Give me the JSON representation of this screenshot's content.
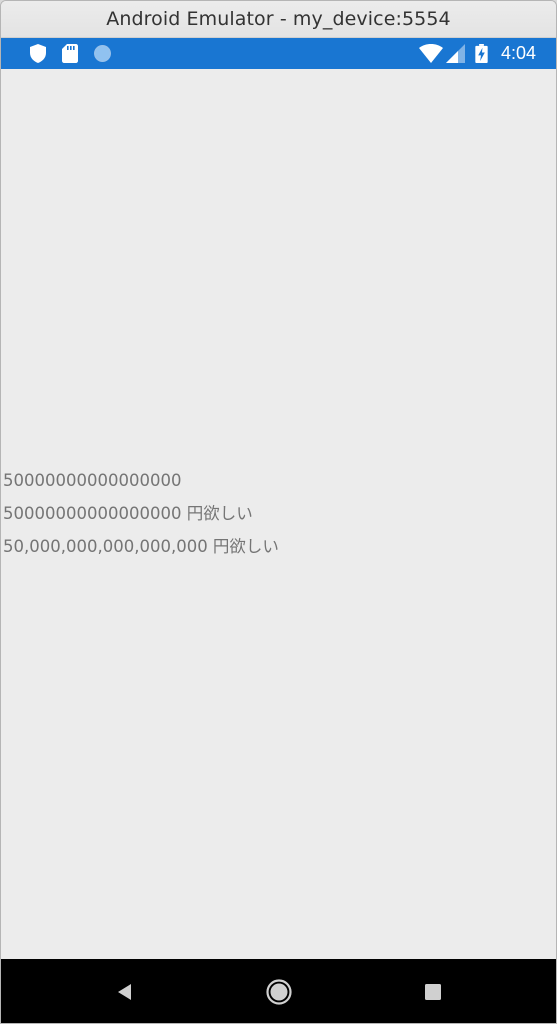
{
  "window": {
    "title": "Android Emulator - my_device:5554"
  },
  "status_bar": {
    "left_icons": [
      "shield-icon",
      "sd-card-icon",
      "sync-circle-icon"
    ],
    "right_icons": [
      "wifi-icon",
      "cell-signal-icon",
      "battery-charging-icon"
    ],
    "time": "4:04",
    "color": "#1976d2"
  },
  "content": {
    "lines": [
      "50000000000000000",
      "50000000000000000 円欲しい",
      "50,000,000,000,000,000 円欲しい"
    ]
  },
  "nav_bar": {
    "buttons": [
      "back-icon",
      "home-icon",
      "recents-icon"
    ]
  }
}
